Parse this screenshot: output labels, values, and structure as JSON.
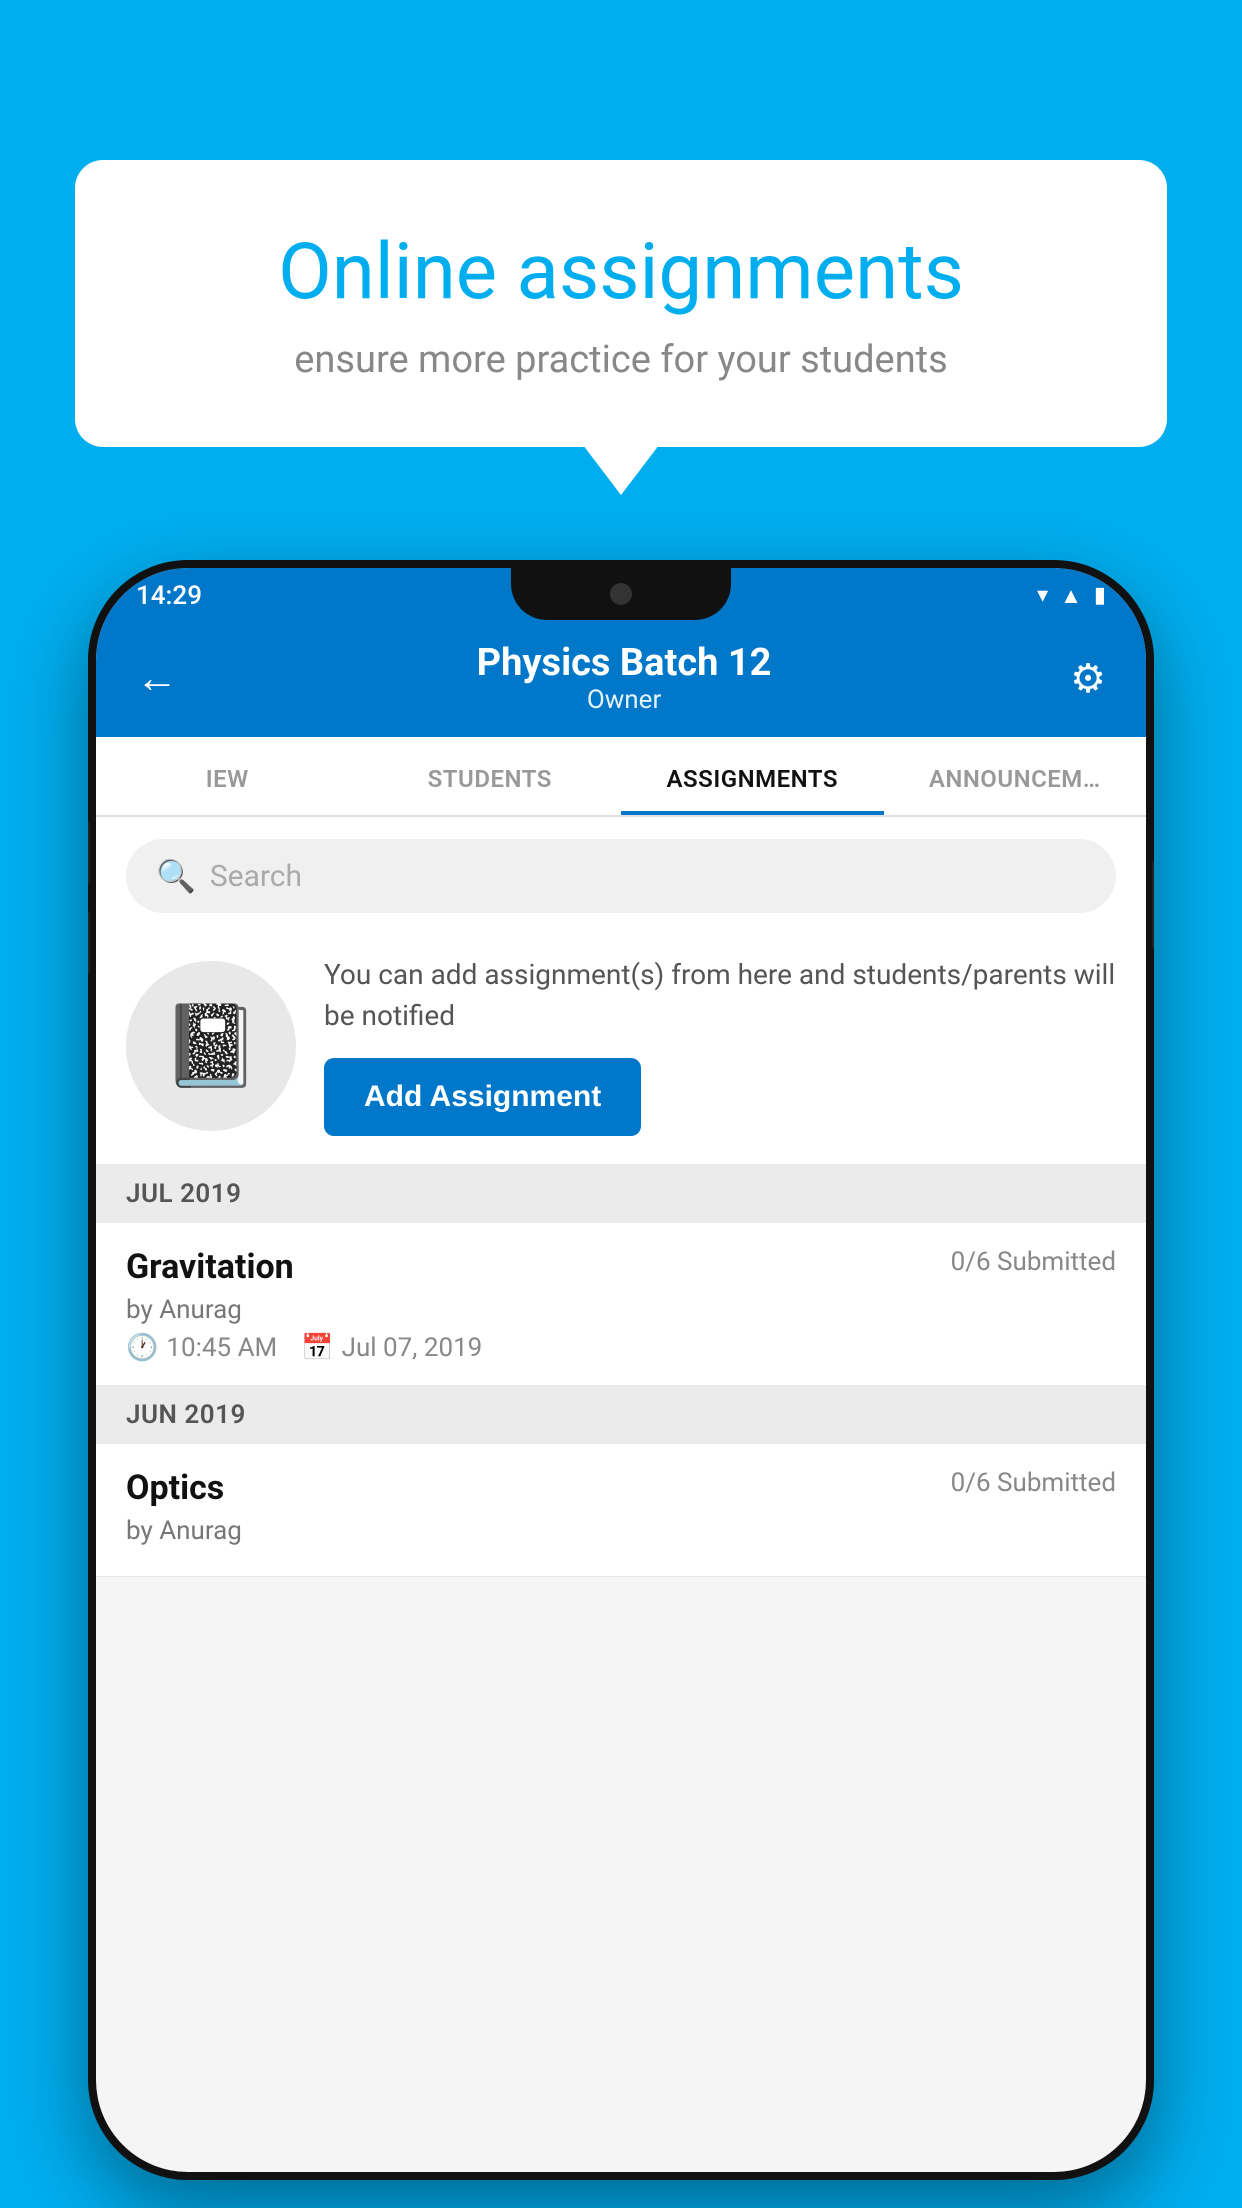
{
  "background_color": "#00AEEF",
  "speech_bubble": {
    "title": "Online assignments",
    "subtitle": "ensure more practice for your students"
  },
  "status_bar": {
    "time": "14:29",
    "icons": [
      "wifi",
      "signal",
      "battery"
    ]
  },
  "header": {
    "title": "Physics Batch 12",
    "subtitle": "Owner",
    "back_label": "←",
    "settings_label": "⚙"
  },
  "tabs": [
    {
      "label": "IEW",
      "active": false
    },
    {
      "label": "STUDENTS",
      "active": false
    },
    {
      "label": "ASSIGNMENTS",
      "active": true
    },
    {
      "label": "ANNOUNCEM…",
      "active": false
    }
  ],
  "search": {
    "placeholder": "Search"
  },
  "promo": {
    "text": "You can add assignment(s) from here and students/parents will be notified",
    "button_label": "Add Assignment"
  },
  "sections": [
    {
      "month": "JUL 2019",
      "assignments": [
        {
          "name": "Gravitation",
          "submitted": "0/6 Submitted",
          "by": "by Anurag",
          "time": "10:45 AM",
          "date": "Jul 07, 2019"
        }
      ]
    },
    {
      "month": "JUN 2019",
      "assignments": [
        {
          "name": "Optics",
          "submitted": "0/6 Submitted",
          "by": "by Anurag",
          "time": "",
          "date": ""
        }
      ]
    }
  ]
}
